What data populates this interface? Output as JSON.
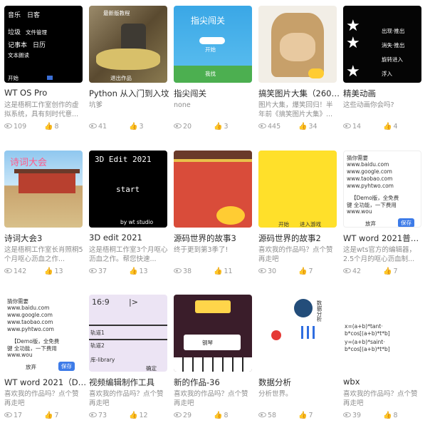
{
  "cards": [
    {
      "title": "WT OS Pro",
      "desc": "这是梧桐工作室创作的虚拟系统，具有刻时代意...",
      "views": "109",
      "likes": "8",
      "thumb_text": [
        "音乐",
        "日客",
        "垃圾",
        "文件管理",
        "记事本",
        "日历",
        "文本朗读",
        "开始"
      ]
    },
    {
      "title": "Python 从入门到入坟",
      "desc": "坑爹",
      "views": "41",
      "likes": "3",
      "thumb_text": [
        "最新版教程",
        "退出作品"
      ]
    },
    {
      "title": "指尖闯关",
      "desc": "none",
      "views": "20",
      "likes": "3",
      "thumb_text": [
        "指尖闯关",
        "开始",
        "我找"
      ]
    },
    {
      "title": "搞笑图片大集（2606张）",
      "desc": "图片大集，爆笑回归！半年前《搞笑图片大集》...",
      "views": "445",
      "likes": "34",
      "thumb_text": []
    },
    {
      "title": "精美动画",
      "desc": "这些动画你会吗?",
      "views": "14",
      "likes": "4",
      "thumb_text": [
        "出现·推出",
        "消失·推出",
        "旋转进入",
        "浮入"
      ]
    },
    {
      "title": "诗词大会3",
      "desc": "这是梧桐工作室长肖照桐5个月呕心沥血之作...",
      "views": "142",
      "likes": "13",
      "thumb_text": [
        "诗词大会"
      ]
    },
    {
      "title": "3D edit 2021",
      "desc": "这是梧桐工作室3个月呕心沥血之作。帮您快速...",
      "views": "37",
      "likes": "13",
      "thumb_text": [
        "3D Edit 2021",
        "start",
        "by wt studio"
      ]
    },
    {
      "title": "源码世界的故事3",
      "desc": "终于更到第3季了!",
      "views": "38",
      "likes": "11",
      "thumb_text": []
    },
    {
      "title": "源码世界的故事2",
      "desc": "喜欢我的作品吗？点个赞再走吧",
      "views": "30",
      "likes": "7",
      "thumb_text": [
        "开始",
        "进入游戏"
      ]
    },
    {
      "title": "WT word 2021普及版",
      "desc": "这是wts官方的编辑器，2.5个月的呕心沥血制...",
      "views": "42",
      "likes": "7",
      "thumb_text": [
        "猜你需要",
        "www.baidu.com",
        "www.google.com",
        "www.taobao.com",
        "www.pyhtwo.com",
        "【Demo版，全免费",
        "键 全功能，一下费用",
        "www.wou",
        "放弃",
        "保存"
      ]
    },
    {
      "title": "WT word 2021（Demo版）",
      "desc": "喜欢我的作品吗？点个赞再走吧",
      "views": "17",
      "likes": "7",
      "thumb_text": [
        "猜你需要",
        "www.baidu.com",
        "www.google.com",
        "www.taobao.com",
        "www.pyhtwo.com",
        "【Demo版，全免费",
        "键 全功能，一下费用",
        "www.wou",
        "放弃",
        "保存"
      ]
    },
    {
      "title": "视频编辑制作工具",
      "desc": "喜欢我的作品吗？点个赞再走吧",
      "views": "73",
      "likes": "12",
      "thumb_text": [
        "16:9",
        "|>",
        "轨道1",
        "轨道2",
        "库-library",
        "确定"
      ]
    },
    {
      "title": "新的作品-36",
      "desc": "喜欢我的作品吗？点个赞再走吧",
      "views": "29",
      "likes": "8",
      "thumb_text": [
        "钢琴"
      ]
    },
    {
      "title": "数据分析",
      "desc": "分析世界。",
      "views": "58",
      "likes": "7",
      "thumb_text": [
        "数据分析"
      ]
    },
    {
      "title": "wbx",
      "desc": "喜欢我的作品吗？点个赞再走吧",
      "views": "39",
      "likes": "8",
      "thumb_text": [
        "x=(a+b)*tant· b*cos[(a+b)*t*b]",
        "y=(a+b)*saint· b*cos[(a+b)*t*b]"
      ]
    }
  ]
}
